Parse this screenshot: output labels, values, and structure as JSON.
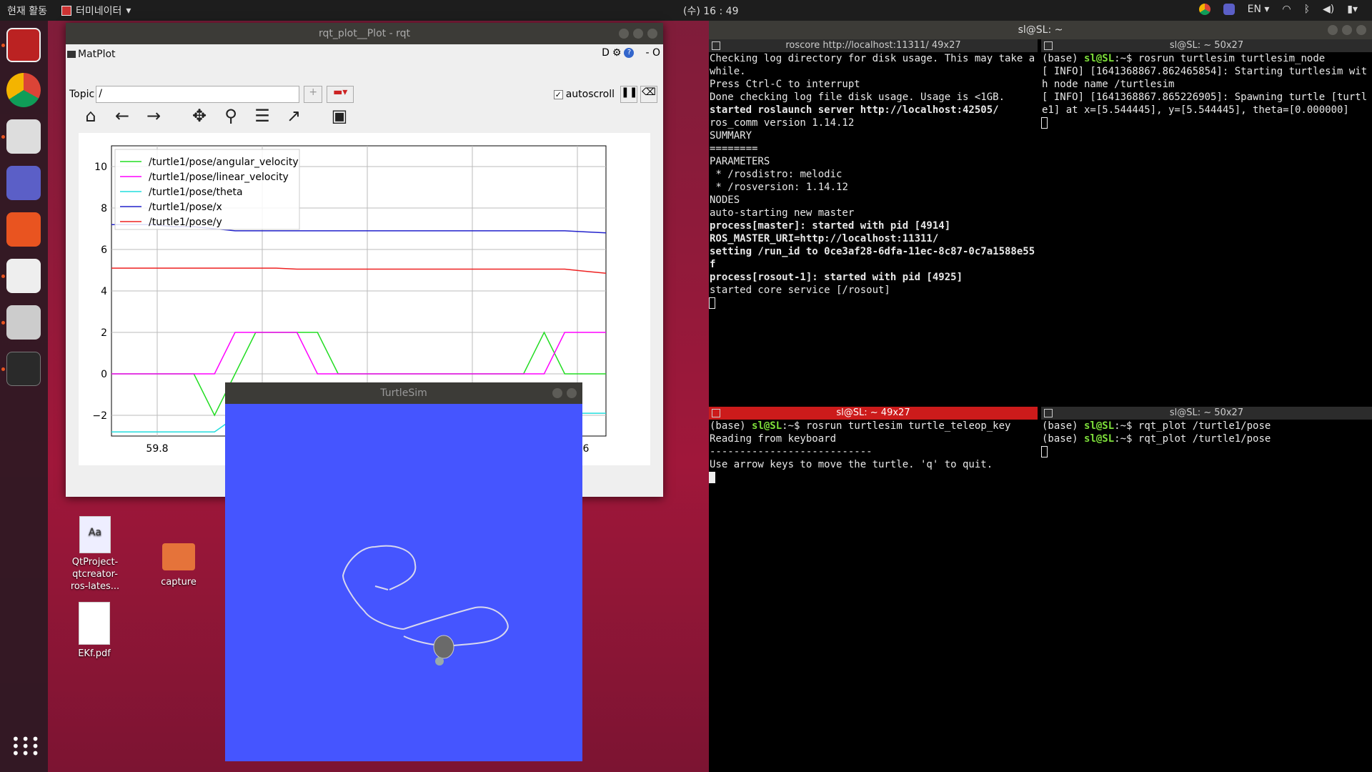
{
  "topbar": {
    "activities": "현재 활동",
    "app_name": "터미네이터",
    "clock": "(수) 16 : 49",
    "lang": "EN"
  },
  "desktop": {
    "icons": [
      {
        "label_lines": [
          "QtProject-",
          "qtcreator-",
          "ros-lates..."
        ],
        "icon": "text-file-icon"
      },
      {
        "label_lines": [
          "capture"
        ],
        "icon": "folder-icon"
      },
      {
        "label_lines": [
          "EKf.pdf"
        ],
        "icon": "pdf-icon"
      }
    ]
  },
  "rqt": {
    "window_title": "rqt_plot__Plot - rqt",
    "plugin_title": "MatPlot",
    "plugin_controls": "D",
    "plugin_dash": "- O",
    "topic_label": "Topic",
    "topic_value": "/",
    "autoscroll_label": "autoscroll",
    "autoscroll_checked": true
  },
  "chart_data": {
    "type": "line",
    "ylim": [
      -3,
      11
    ],
    "yticks": [
      10,
      8,
      6,
      4,
      2,
      0,
      -2
    ],
    "xtick_labels": [
      "59.8",
      "6"
    ],
    "grid": true,
    "legend_position": "top-left",
    "series": [
      {
        "name": "/turtle1/pose/angular_velocity",
        "color": "#22dd22",
        "values": [
          0,
          0,
          0,
          0,
          0,
          -2,
          0,
          2,
          2,
          2,
          2,
          0,
          0,
          0,
          0,
          0,
          0,
          0,
          0,
          0,
          0,
          2,
          0,
          0,
          0
        ]
      },
      {
        "name": "/turtle1/pose/linear_velocity",
        "color": "#ff00ff",
        "values": [
          0,
          0,
          0,
          0,
          0,
          0,
          2,
          2,
          2,
          2,
          0,
          0,
          0,
          0,
          0,
          0,
          0,
          0,
          0,
          0,
          0,
          0,
          2,
          2,
          2
        ]
      },
      {
        "name": "/turtle1/pose/theta",
        "color": "#22dddd",
        "values": [
          -2.8,
          -2.8,
          -2.8,
          -2.8,
          -2.8,
          -2.8,
          -2.1,
          -2.1,
          -2.1,
          -2.1,
          -2.1,
          -2.1,
          -2.1,
          -2.1,
          -2.1,
          -2.1,
          -2.1,
          -2.1,
          -2.1,
          -2.1,
          -2.1,
          -2.1,
          -1.9,
          -1.9,
          -1.9
        ]
      },
      {
        "name": "/turtle1/pose/x",
        "color": "#2222cc",
        "values": [
          7.2,
          7.2,
          7.2,
          7.1,
          7.1,
          7.0,
          6.9,
          6.9,
          6.9,
          6.9,
          6.9,
          6.9,
          6.9,
          6.9,
          6.9,
          6.9,
          6.9,
          6.9,
          6.9,
          6.9,
          6.9,
          6.9,
          6.9,
          6.85,
          6.8
        ]
      },
      {
        "name": "/turtle1/pose/y",
        "color": "#ee2222",
        "values": [
          5.1,
          5.1,
          5.1,
          5.1,
          5.1,
          5.1,
          5.1,
          5.1,
          5.1,
          5.05,
          5.05,
          5.05,
          5.05,
          5.05,
          5.05,
          5.05,
          5.05,
          5.05,
          5.05,
          5.05,
          5.05,
          5.05,
          5.05,
          4.95,
          4.85
        ]
      }
    ]
  },
  "turtlesim": {
    "window_title": "TurtleSim",
    "background": "#4555ff"
  },
  "terminator": {
    "window_title": "sl@SL: ~",
    "panes": [
      {
        "title": "roscore http://localhost:11311/ 49x27",
        "active": false,
        "lines": [
          "Checking log directory for disk usage. This may take a while.",
          "Press Ctrl-C to interrupt",
          "Done checking log file disk usage. Usage is <1GB.",
          "",
          "started roslaunch server http://localhost:42505/",
          "ros_comm version 1.14.12",
          "",
          "",
          "SUMMARY",
          "========",
          "",
          "PARAMETERS",
          " * /rosdistro: melodic",
          " * /rosversion: 1.14.12",
          "",
          "NODES",
          "",
          "auto-starting new master",
          "process[master]: started with pid [4914]",
          "ROS_MASTER_URI=http://localhost:11311/",
          "",
          "setting /run_id to 0ce3af28-6dfa-11ec-8c87-0c7a1588e55f",
          "process[rosout-1]: started with pid [4925]",
          "started core service [/rosout]"
        ]
      },
      {
        "title": "sl@SL: ~ 50x27",
        "active": false,
        "lines": [
          "(base) sl@SL:~$ rosrun turtlesim turtlesim_node",
          "[ INFO] [1641368867.862465854]: Starting turtlesim with node name /turtlesim",
          "[ INFO] [1641368867.865226905]: Spawning turtle [turtle1] at x=[5.544445], y=[5.544445], theta=[0.000000]"
        ]
      },
      {
        "title": "sl@SL: ~ 49x27",
        "active": true,
        "lines": [
          "(base) sl@SL:~$ rosrun turtlesim turtle_teleop_key",
          "Reading from keyboard",
          "---------------------------",
          "Use arrow keys to move the turtle. 'q' to quit."
        ]
      },
      {
        "title": "sl@SL: ~ 50x27",
        "active": false,
        "lines": [
          "(base) sl@SL:~$ rqt_plot /turtle1/pose",
          "(base) sl@SL:~$ rqt_plot /turtle1/pose"
        ]
      }
    ]
  }
}
